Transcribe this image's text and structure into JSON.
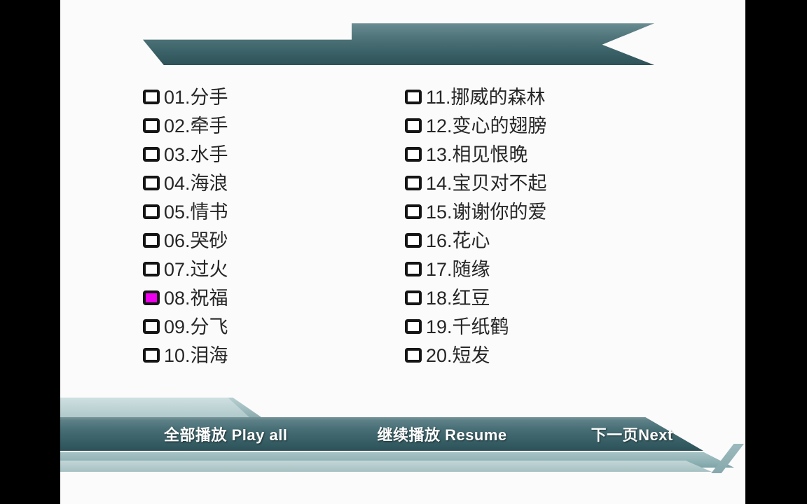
{
  "screen": {
    "background_color": "#000000",
    "content_background": "#fbfbfb",
    "accent_color": "#46696f",
    "selected_color": "#ee00ee",
    "text_color": "#262626"
  },
  "banner": {
    "title": "",
    "name": "title-ribbon"
  },
  "playlist": {
    "left_column": [
      {
        "number": "01.",
        "title": "分手",
        "label": "01.分手",
        "selected": false
      },
      {
        "number": "02.",
        "title": "牵手",
        "label": "02.牵手",
        "selected": false
      },
      {
        "number": "03.",
        "title": "水手",
        "label": "03.水手",
        "selected": false
      },
      {
        "number": "04.",
        "title": "海浪",
        "label": "04.海浪",
        "selected": false
      },
      {
        "number": "05.",
        "title": "情书",
        "label": "05.情书",
        "selected": false
      },
      {
        "number": "06.",
        "title": "哭砂",
        "label": "06.哭砂",
        "selected": false
      },
      {
        "number": "07.",
        "title": "过火",
        "label": "07.过火",
        "selected": false
      },
      {
        "number": "08.",
        "title": "祝福",
        "label": "08.祝福",
        "selected": true
      },
      {
        "number": "09.",
        "title": "分飞",
        "label": "09.分飞",
        "selected": false
      },
      {
        "number": "10.",
        "title": "泪海",
        "label": "10.泪海",
        "selected": false
      }
    ],
    "right_column": [
      {
        "number": "11.",
        "title": "挪威的森林",
        "label": "11.挪威的森林",
        "selected": false
      },
      {
        "number": "12.",
        "title": "变心的翅膀",
        "label": "12.变心的翅膀",
        "selected": false
      },
      {
        "number": "13.",
        "title": "相见恨晚",
        "label": "13.相见恨晚",
        "selected": false
      },
      {
        "number": "14.",
        "title": "宝贝对不起",
        "label": "14.宝贝对不起",
        "selected": false
      },
      {
        "number": "15.",
        "title": "谢谢你的爱",
        "label": "15.谢谢你的爱",
        "selected": false
      },
      {
        "number": "16.",
        "title": "花心",
        "label": "16.花心",
        "selected": false
      },
      {
        "number": "17.",
        "title": "随缘",
        "label": "17.随缘",
        "selected": false
      },
      {
        "number": "18.",
        "title": "红豆",
        "label": "18.红豆",
        "selected": false
      },
      {
        "number": "19.",
        "title": "千纸鹤",
        "label": "19.千纸鹤",
        "selected": false
      },
      {
        "number": "20.",
        "title": "短发",
        "label": "20.短发",
        "selected": false
      }
    ],
    "selected_track": "08.祝福"
  },
  "navbar": {
    "play_all": "全部播放  Play all",
    "resume": "继续播放  Resume",
    "next_page": "下一页Next"
  }
}
